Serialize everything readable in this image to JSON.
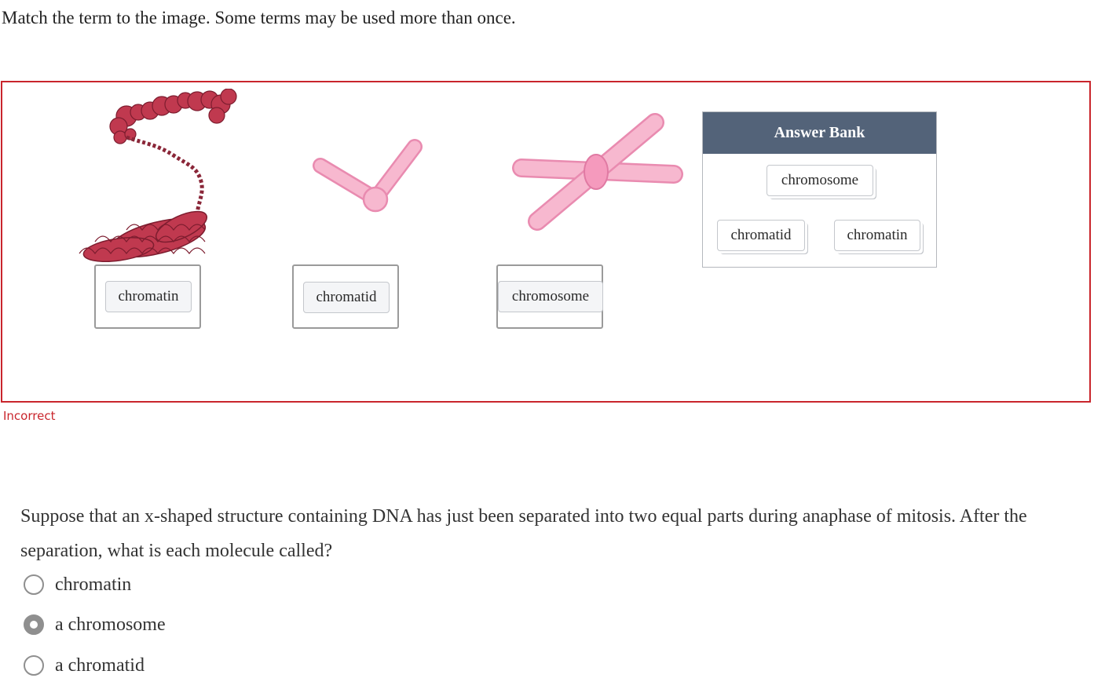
{
  "question1": {
    "prompt": "Match the term to the image. Some terms may be used more than once.",
    "targets": [
      {
        "figure": "chromatin-fiber-image",
        "placed_term": "chromatin"
      },
      {
        "figure": "single-chromatid-image",
        "placed_term": "chromatid"
      },
      {
        "figure": "x-chromosome-image",
        "placed_term": "chromosome"
      }
    ],
    "answer_bank": {
      "title": "Answer Bank",
      "terms": [
        "chromosome",
        "chromatid",
        "chromatin"
      ]
    },
    "status": "Incorrect"
  },
  "question2": {
    "prompt": "Suppose that an x-shaped structure containing DNA has just been separated into two equal parts during anaphase of mitosis. After the separation, what is each molecule called?",
    "options": [
      "chromatin",
      "a chromosome",
      "a chromatid"
    ],
    "selected_option": "a chromosome"
  },
  "colors": {
    "error": "#c9252c",
    "bank_header": "#536379",
    "chromosome_pink": "#f7b8cf",
    "chromatin_red": "#c0394f"
  }
}
